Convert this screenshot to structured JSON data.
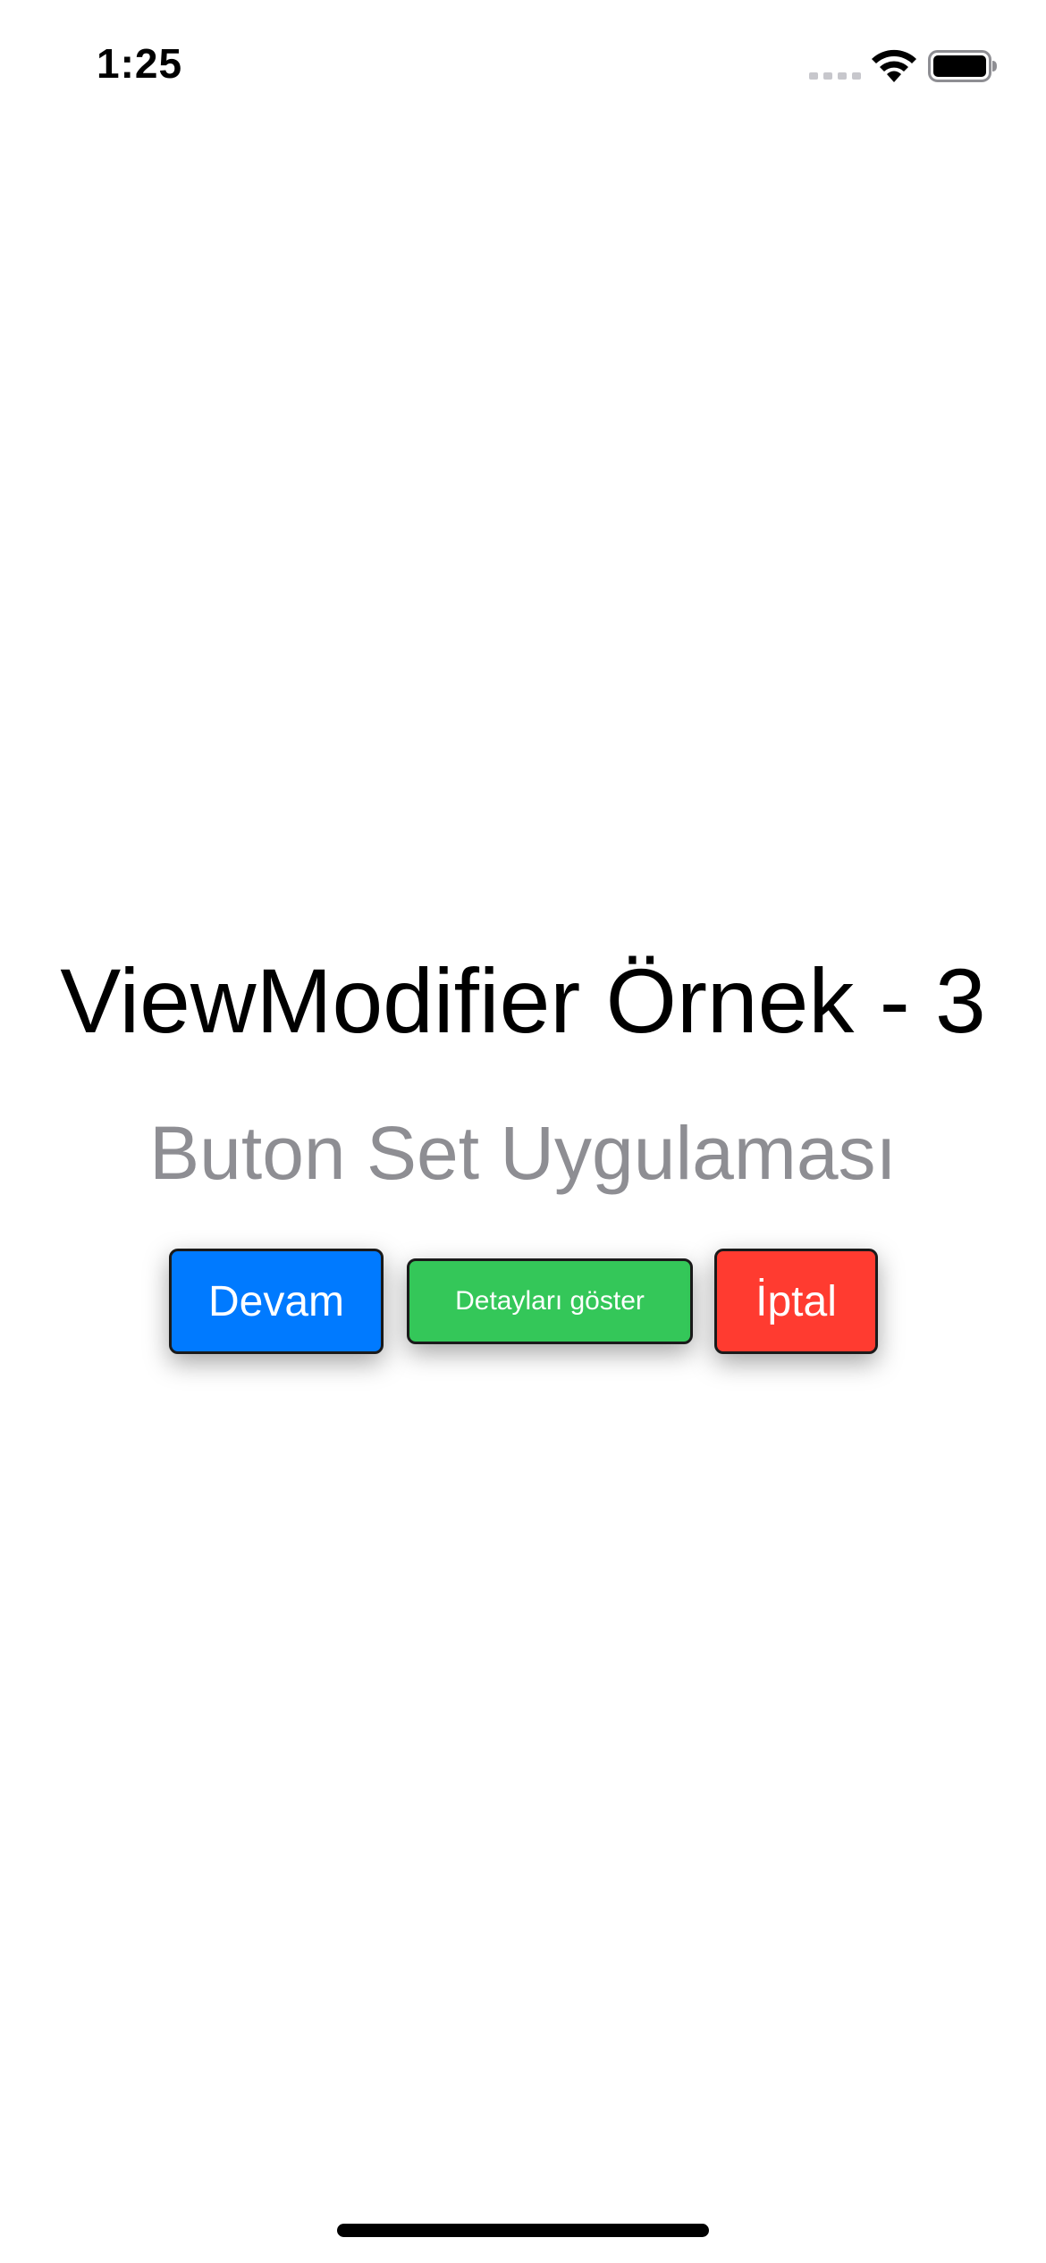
{
  "status_bar": {
    "time": "1:25",
    "icons": [
      "signal-icon",
      "wifi-icon",
      "battery-icon"
    ]
  },
  "main": {
    "title": "ViewModifier Örnek - 3",
    "subtitle": "Buton Set Uygulaması",
    "buttons": [
      {
        "label": "Devam",
        "color": "#007aff"
      },
      {
        "label": "Detayları göster",
        "color": "#34c759"
      },
      {
        "label": "İptal",
        "color": "#ff3b30"
      }
    ]
  },
  "colors": {
    "background": "#ffffff",
    "title_text": "#000000",
    "subtitle_text": "#8e8e93",
    "button_text": "#ffffff",
    "button_border": "#1a1a1a"
  }
}
